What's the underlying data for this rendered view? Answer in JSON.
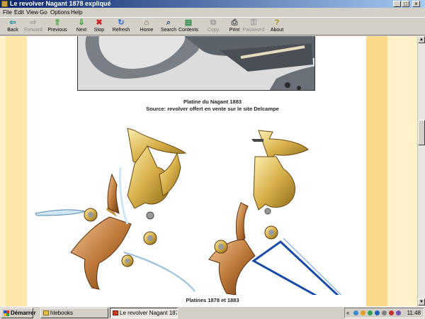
{
  "window": {
    "title": "Le revolver Nagant 1878 expliqué",
    "controls": {
      "minimize": "_",
      "maximize": "□",
      "close": "×"
    }
  },
  "menu": [
    "File",
    "Edit",
    "View",
    "Go",
    "Options",
    "Help"
  ],
  "toolbar": [
    {
      "label": "Back",
      "icon": "back-arrow-icon",
      "glyph": "⇦",
      "color": "#1a8a9a",
      "enabled": true
    },
    {
      "label": "Forward",
      "icon": "forward-arrow-icon",
      "glyph": "⇨",
      "color": "#9a9a9a",
      "enabled": false
    },
    {
      "label": "Previous",
      "icon": "up-arrow-icon",
      "glyph": "⇧",
      "color": "#2aa02a",
      "enabled": true
    },
    {
      "label": "Next",
      "icon": "down-arrow-icon",
      "glyph": "⇩",
      "color": "#2aa02a",
      "enabled": true
    },
    {
      "label": "Stop",
      "icon": "stop-icon",
      "glyph": "✖",
      "color": "#d02020",
      "enabled": true
    },
    {
      "label": "Refresh",
      "icon": "refresh-icon",
      "glyph": "↻",
      "color": "#2a6ad0",
      "enabled": true
    },
    {
      "label": "Home",
      "icon": "home-icon",
      "glyph": "⌂",
      "color": "#6a4a2a",
      "enabled": true
    },
    {
      "label": "Search",
      "icon": "search-icon",
      "glyph": "⌕",
      "color": "#2a4a8a",
      "enabled": true
    },
    {
      "label": "Contents",
      "icon": "contents-icon",
      "glyph": "▤",
      "color": "#2a8a4a",
      "enabled": true
    },
    {
      "label": "Copy",
      "icon": "copy-icon",
      "glyph": "⧉",
      "color": "#9a9a9a",
      "enabled": false
    },
    {
      "label": "Print",
      "icon": "print-icon",
      "glyph": "⎙",
      "color": "#4a4a4a",
      "enabled": true
    },
    {
      "label": "Password",
      "icon": "key-icon",
      "glyph": "⚿",
      "color": "#9a9a9a",
      "enabled": false
    },
    {
      "label": "About",
      "icon": "about-icon",
      "glyph": "?",
      "color": "#b08a10",
      "enabled": true
    }
  ],
  "page": {
    "caption1": "Platine du Nagant 1883",
    "caption2": "Source: revolver offert en vente sur le site Delcampe",
    "caption3": "Platines 1878 et 1883"
  },
  "taskbar": {
    "start": "Démarrer",
    "tasks": [
      {
        "label": "hlebooks",
        "active": false
      },
      {
        "label": "Le revolver Nagant 1878 ...",
        "active": true
      }
    ],
    "tray_chevron": "«",
    "clock": "11:48"
  },
  "colors": {
    "band_light": "#fff1c8",
    "band_mid": "#fde7a8",
    "band_right": "#fcd98a",
    "brass": "#d8b04a",
    "spring_blue": "#1a4aa8"
  }
}
